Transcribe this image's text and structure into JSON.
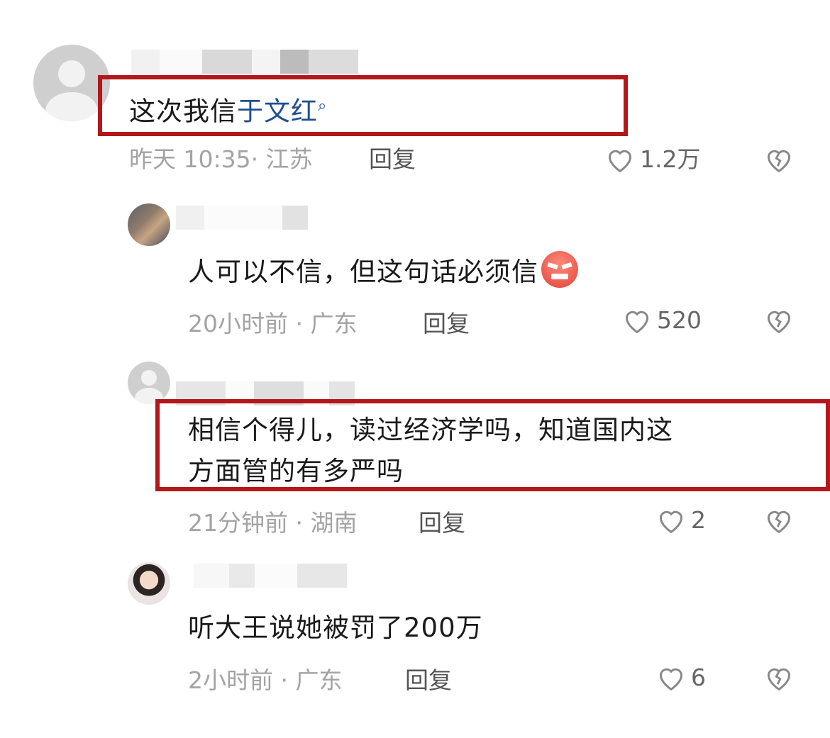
{
  "comments": [
    {
      "text_prefix": "这次我信",
      "text_link": "于文红",
      "time": "昨天 10:35",
      "location": "江苏",
      "reply_label": "回复",
      "likes": "1.2万"
    },
    {
      "text": "人可以不信，但这句话必须信",
      "emoji": "angry-face-emoji",
      "time": "20小时前",
      "location": "广东",
      "reply_label": "回复",
      "likes": "520"
    },
    {
      "text_line1": "相信个得儿，读过经济学吗，知道国内这",
      "text_line2": "方面管的有多严吗",
      "time": "21分钟前",
      "location": "湖南",
      "reply_label": "回复",
      "likes": "2"
    },
    {
      "text": "听大王说她被罚了200万",
      "time": "2小时前",
      "location": "广东",
      "reply_label": "回复",
      "likes": "6"
    }
  ],
  "colors": {
    "highlight": "#b3171b",
    "link": "#1f4f8f",
    "meta": "#a3a3a3"
  },
  "icons": [
    "search-icon",
    "heart-icon",
    "broken-heart-icon"
  ]
}
